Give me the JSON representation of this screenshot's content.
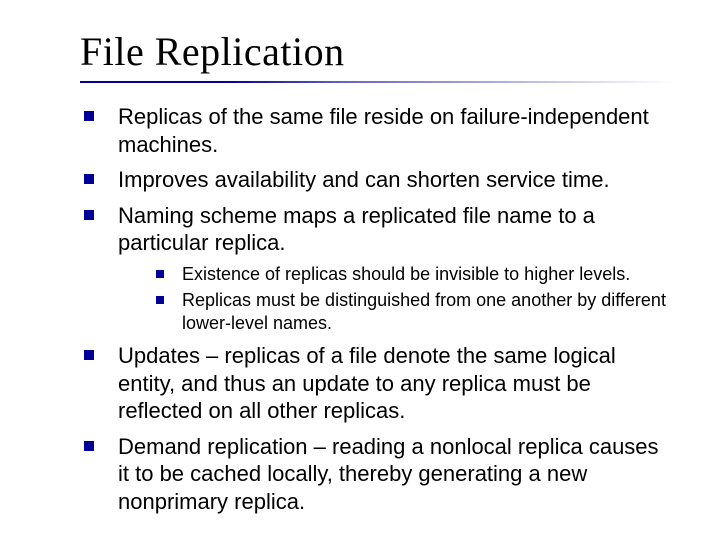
{
  "title": "File Replication",
  "bullets": {
    "b0": "Replicas of the same file reside on failure-independent machines.",
    "b1": "Improves availability and can shorten service time.",
    "b2": "Naming scheme maps a replicated file name to a particular replica.",
    "b2_sub": {
      "s0": "Existence of replicas should be invisible to higher levels.",
      "s1": "Replicas must be distinguished from one another by different lower-level names."
    },
    "b3": "Updates – replicas of a file denote the same logical entity, and thus an update to any replica must be reflected on all other replicas.",
    "b4": "Demand replication – reading a nonlocal replica causes it to be cached locally, thereby generating a new nonprimary replica."
  }
}
